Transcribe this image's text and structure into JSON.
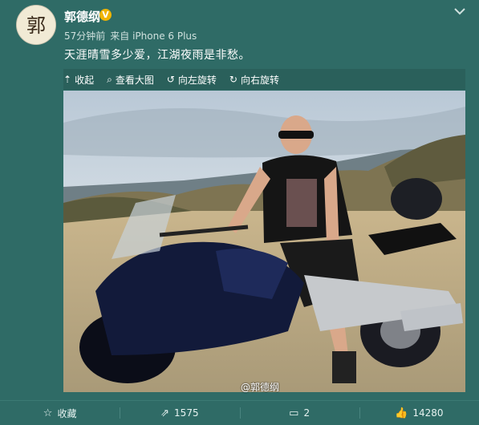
{
  "user": {
    "name": "郭德纲",
    "avatar_text": "郭",
    "verified_mark": "V"
  },
  "meta": {
    "time": "57分钟前",
    "source": "来自 iPhone 6 Plus"
  },
  "post": {
    "text": "天涯晴雪多少爱，江湖夜雨是非愁。"
  },
  "image_toolbar": {
    "collapse_label": "收起",
    "view_large_label": "查看大图",
    "rotate_left_label": "向左旋转",
    "rotate_right_label": "向右旋转"
  },
  "photo": {
    "watermark": "@郭德纲"
  },
  "actions": {
    "favorite_label": "收藏",
    "repost_count": "1575",
    "comment_count": "2",
    "like_count": "14280"
  },
  "colors": {
    "background": "#2f6b66",
    "verified": "#f0b400"
  },
  "icons": [
    "chevron-down-icon",
    "collapse-icon",
    "zoom-icon",
    "rotate-left-icon",
    "rotate-right-icon",
    "star-icon",
    "repost-icon",
    "comment-icon",
    "like-icon"
  ]
}
